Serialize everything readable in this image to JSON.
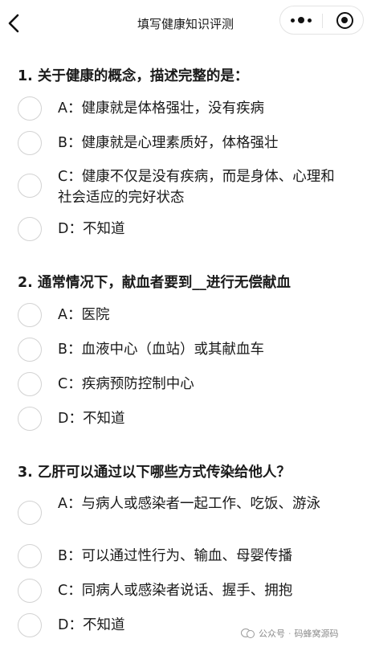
{
  "nav": {
    "title": "填写健康知识评测"
  },
  "questions": [
    {
      "title": "1. 关于健康的概念，描述完整的是：",
      "options": [
        "A：健康就是体格强壮，没有疾病",
        "B：健康就是心理素质好，体格强壮",
        "C：健康不仅是没有疾病，而是身体、心理和社会适应的完好状态",
        "D：不知道"
      ]
    },
    {
      "title": "2. 通常情况下，献血者要到__进行无偿献血",
      "options": [
        "A：医院",
        "B：血液中心（血站）或其献血车",
        "C：疾病预防控制中心",
        "D：不知道"
      ]
    },
    {
      "title": "3. 乙肝可以通过以下哪些方式传染给他人？",
      "options": [
        "A：与病人或感染者一起工作、吃饭、游泳",
        "B：可以通过性行为、输血、母婴传播",
        "C：同病人或感染者说话、握手、拥抱",
        "D：不知道"
      ]
    }
  ],
  "watermark": {
    "source": "公众号",
    "sep": "·",
    "name": "码蜂窝源码"
  }
}
